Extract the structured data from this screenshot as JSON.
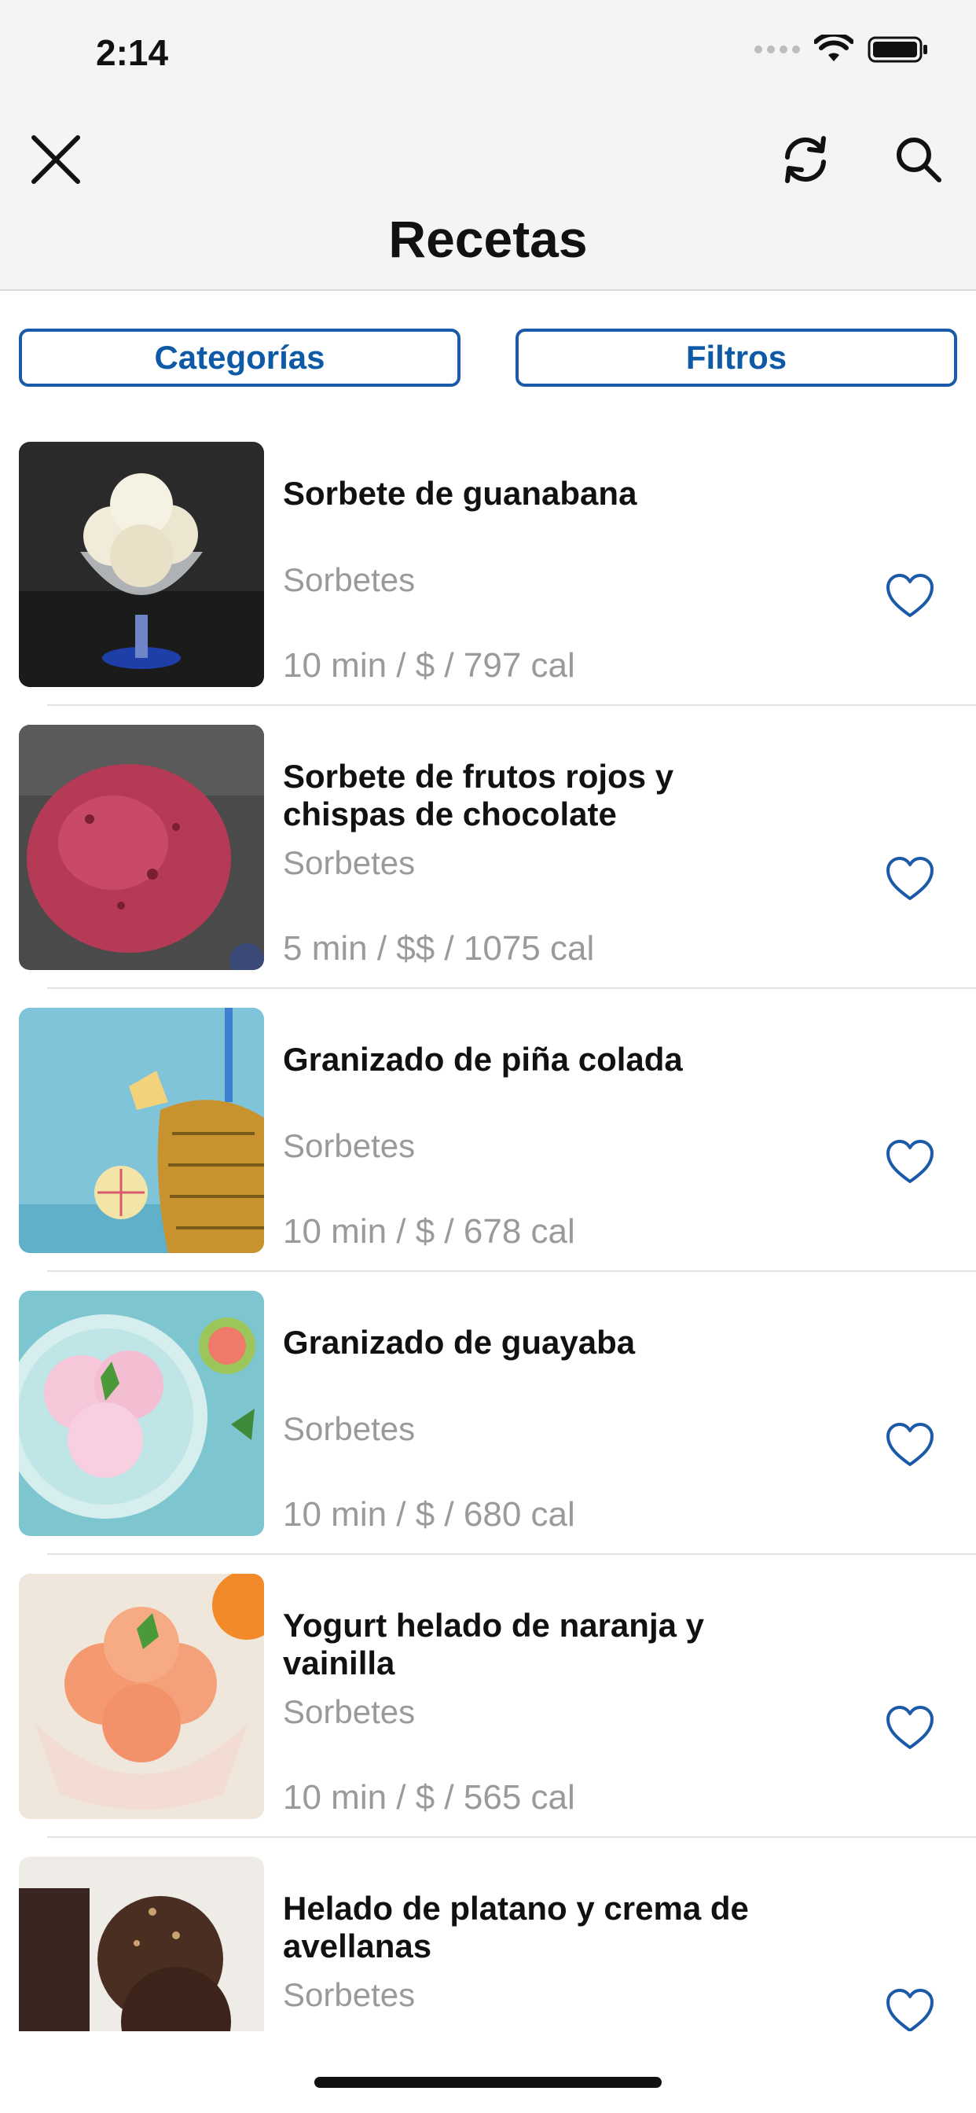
{
  "status_bar": {
    "time": "2:14"
  },
  "header": {
    "title": "Recetas",
    "icons": [
      "close-icon",
      "refresh-icon",
      "search-icon"
    ]
  },
  "filters": {
    "categories_label": "Categorías",
    "filters_label": "Filtros"
  },
  "colors": {
    "accent": "#1a5aa8",
    "header_bg": "#f4f4f4",
    "secondary_text": "#9a9a9a"
  },
  "recipes": [
    {
      "title": "Sorbete de guanabana",
      "category": "Sorbetes",
      "meta": "10 min / $ / 797 cal",
      "image": "vanilla-ice-cream-cup"
    },
    {
      "title": "Sorbete de frutos rojos y chispas de chocolate",
      "category": "Sorbetes",
      "meta": "5 min / $$ / 1075 cal",
      "image": "berry-sorbet-scoop"
    },
    {
      "title": "Granizado de piña colada",
      "category": "Sorbetes",
      "meta": "10 min / $ / 678 cal",
      "image": "pineapple-drink"
    },
    {
      "title": "Granizado de guayaba",
      "category": "Sorbetes",
      "meta": "10 min / $ / 680 cal",
      "image": "pink-guava-scoops"
    },
    {
      "title": "Yogurt helado de naranja y vainilla",
      "category": "Sorbetes",
      "meta": "10 min / $ / 565 cal",
      "image": "orange-ice-cream-bowl"
    },
    {
      "title": "Helado de platano y crema de avellanas",
      "category": "Sorbetes",
      "meta": "",
      "image": "chocolate-ice-cream"
    }
  ]
}
